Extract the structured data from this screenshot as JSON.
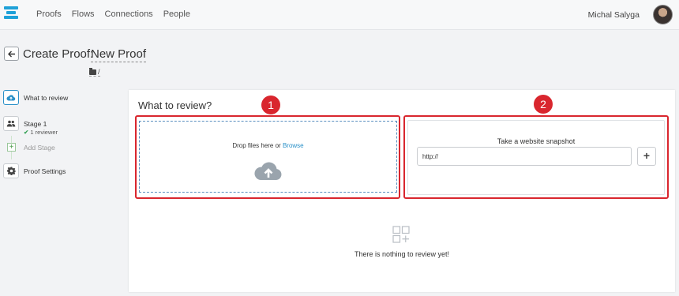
{
  "nav": {
    "items": [
      "Proofs",
      "Flows",
      "Connections",
      "People"
    ],
    "user_name": "Michal Salyga"
  },
  "header": {
    "title": "Create Proof:",
    "proof_name": "New Proof",
    "folder_path": "/"
  },
  "sidebar": {
    "items": [
      {
        "label": "What to review",
        "icon": "cloud-upload-icon"
      },
      {
        "label": "Stage 1",
        "sub": "1 reviewer",
        "icon": "people-icon"
      },
      {
        "label": "Add Stage",
        "icon": "plus-icon"
      },
      {
        "label": "Proof Settings",
        "icon": "gear-icon"
      }
    ]
  },
  "main": {
    "title": "What to review?",
    "drop_text": "Drop files here or ",
    "browse_label": "Browse",
    "snapshot_title": "Take a website snapshot",
    "url_value": "http://",
    "add_label": "+",
    "empty_text": "There is nothing to review yet!"
  },
  "badges": [
    "1",
    "2"
  ],
  "colors": {
    "accent": "#2a90c8",
    "highlight": "#d9262e",
    "logo": "#1fa1d8"
  }
}
